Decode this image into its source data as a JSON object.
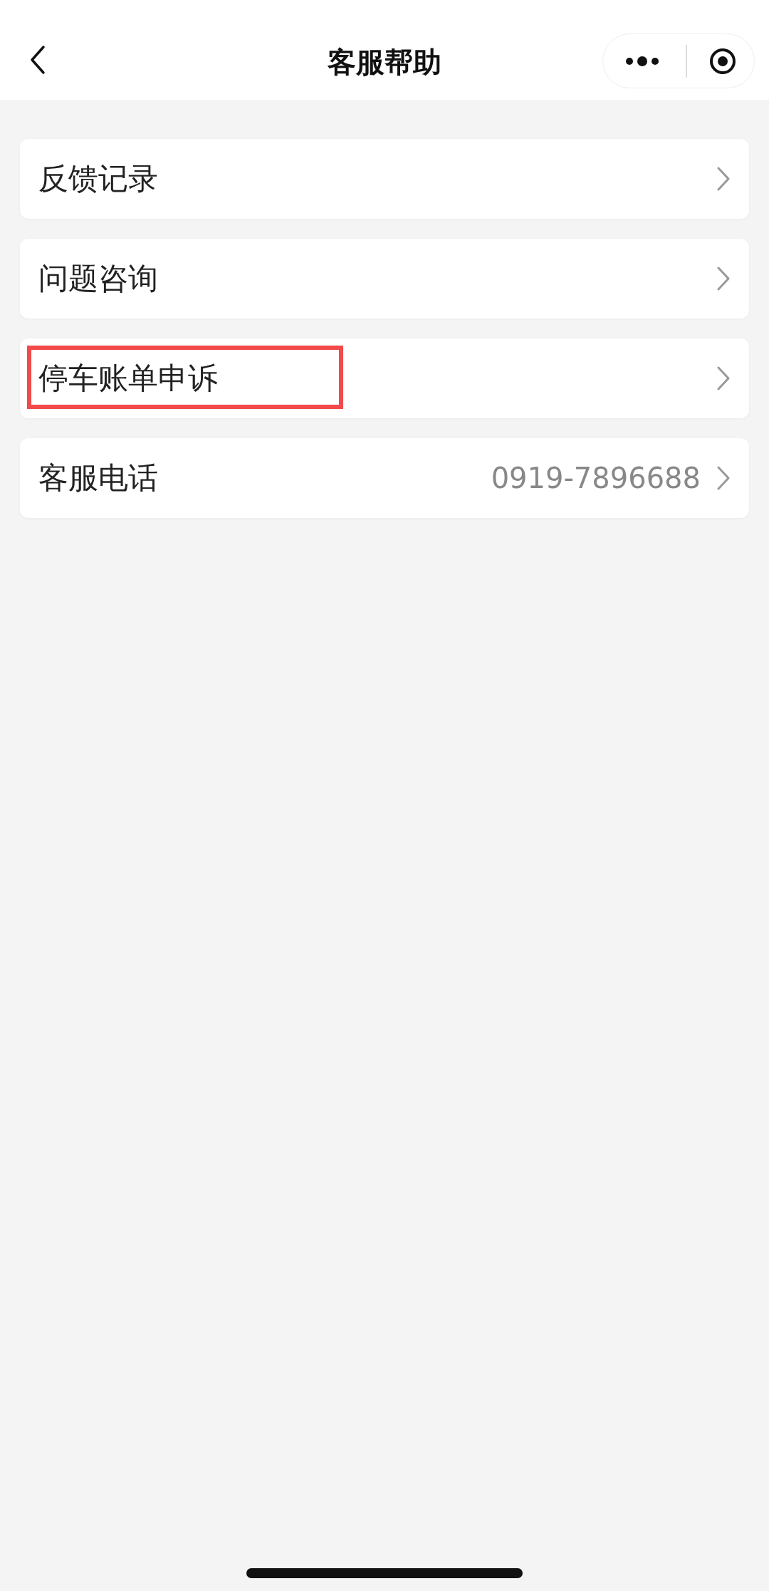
{
  "nav_bar": {
    "title": "客服帮助"
  },
  "menu_items": [
    {
      "label": "反馈记录",
      "highlighted": false
    },
    {
      "label": "问题咨询",
      "highlighted": false
    },
    {
      "label": "停车账单申诉",
      "highlighted": true
    },
    {
      "label": "客服电话",
      "value": "0919-7896688",
      "highlighted": false
    }
  ]
}
